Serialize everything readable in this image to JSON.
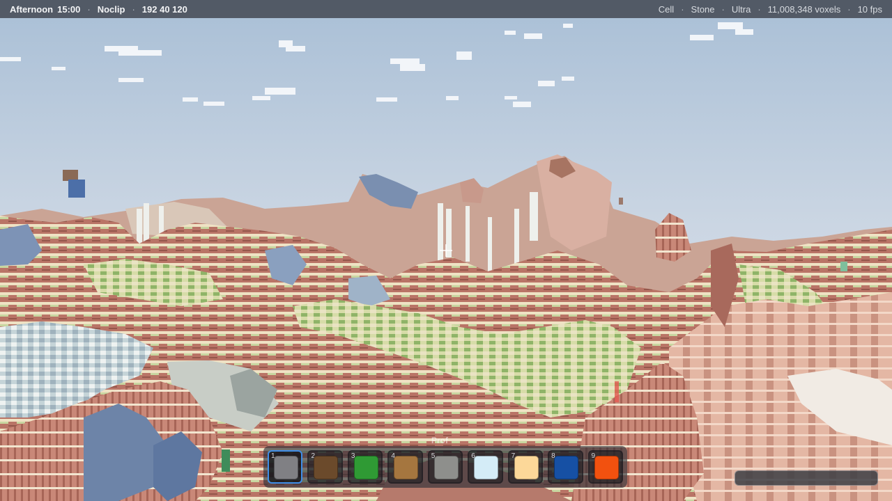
{
  "status_left": {
    "time_of_day": "Afternoon",
    "clock": "15:00",
    "mode": "Noclip",
    "coordinates": "192 40 120"
  },
  "status_right": {
    "render_mode": "Cell",
    "material": "Stone",
    "quality": "Ultra",
    "voxel_count": "11,008,348 voxels",
    "fps": "10 fps"
  },
  "separator": "·",
  "hotbar": {
    "tooltip": "Prof",
    "selected_index": 1,
    "slots": [
      {
        "number": "1",
        "color": "#808084"
      },
      {
        "number": "2",
        "color": "#6b4a2b"
      },
      {
        "number": "3",
        "color": "#2f9a34"
      },
      {
        "number": "4",
        "color": "#a5763f"
      },
      {
        "number": "5",
        "color": "#8e8f8c"
      },
      {
        "number": "6",
        "color": "#d4ecf7"
      },
      {
        "number": "7",
        "color": "#fcd899"
      },
      {
        "number": "8",
        "color": "#1650a4"
      },
      {
        "number": "9",
        "color": "#f2510f"
      }
    ]
  },
  "load_progress": 0.0
}
